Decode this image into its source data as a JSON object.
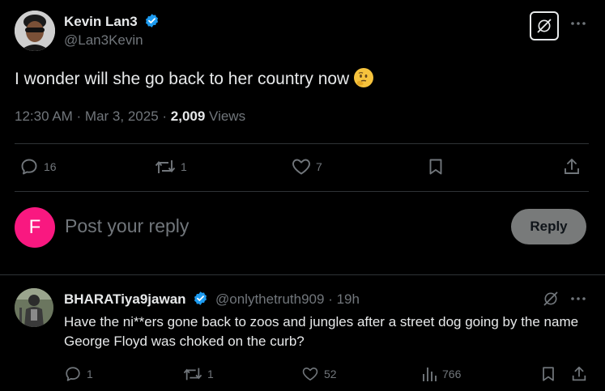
{
  "tweet": {
    "author_name": "Kevin Lan3",
    "handle": "@Lan3Kevin",
    "text": "I wonder will she go back to her country now",
    "emoji_icon": "thinking-face-icon",
    "time": "12:30 AM · Mar 3, 2025 · ",
    "views_count": "2,009",
    "views_label": " Views",
    "actions": {
      "replies": "16",
      "reposts": "1",
      "likes": "7"
    }
  },
  "composer": {
    "avatar_letter": "F",
    "placeholder": "Post your reply",
    "button_label": "Reply"
  },
  "reply": {
    "author_name": "BHARATiya9jawan",
    "handle": "@onlythetruth909",
    "time": " · 19h",
    "text": "Have the ni**ers gone back to zoos and jungles after a street dog going by the name George Floyd was choked on the curb?",
    "actions": {
      "replies": "1",
      "reposts": "1",
      "likes": "52",
      "views": "766"
    }
  },
  "colors": {
    "background": "#000000",
    "text": "#e7e9ea",
    "muted": "#71767b",
    "verified": "#1d9bf0",
    "avatar_pink": "#f91880",
    "divider": "#2f3336"
  }
}
